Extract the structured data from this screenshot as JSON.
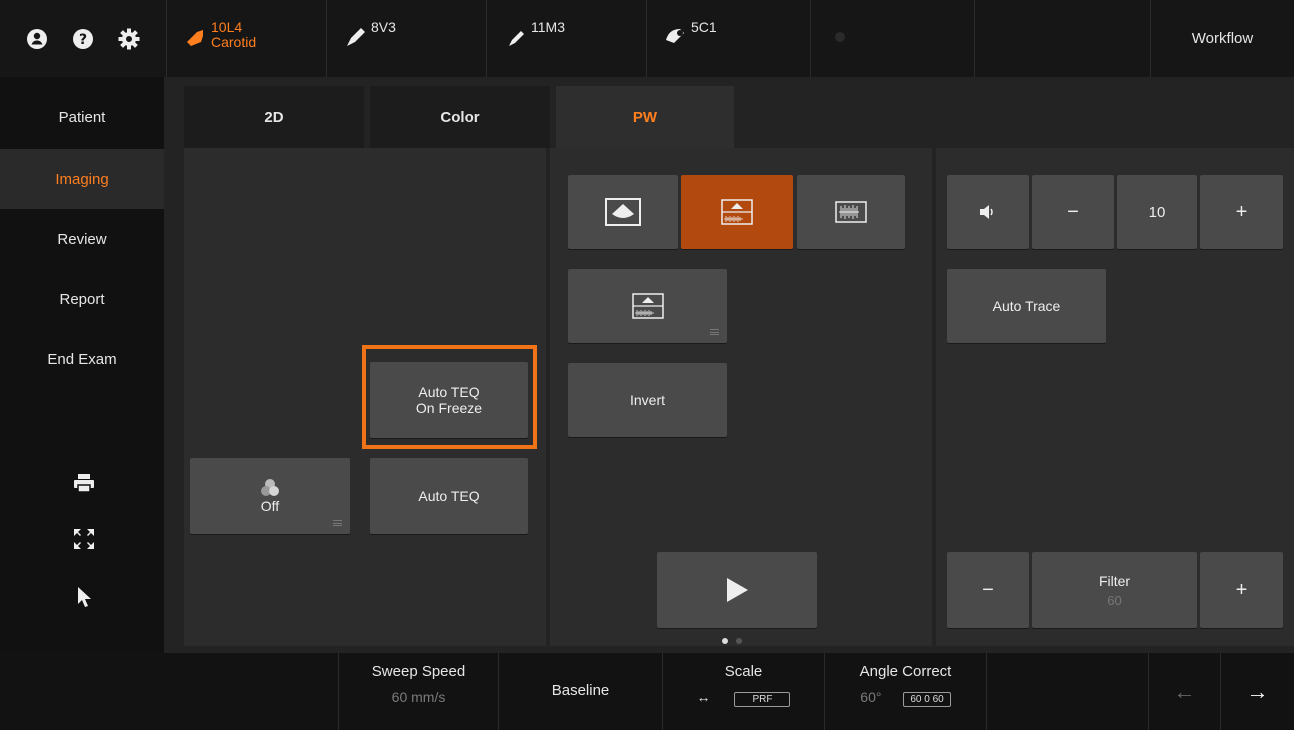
{
  "top": {
    "icons": [
      "user-circle-icon",
      "help-circle-icon",
      "gear-icon"
    ],
    "probes": [
      {
        "name": "10L4",
        "preset": "Carotid",
        "active": true
      },
      {
        "name": "8V3",
        "preset": "",
        "active": false
      },
      {
        "name": "11M3",
        "preset": "",
        "active": false
      },
      {
        "name": "5C1",
        "preset": "",
        "active": false
      }
    ],
    "workflow": "Workflow"
  },
  "sidebar": {
    "items": [
      {
        "label": "Patient",
        "active": false
      },
      {
        "label": "Imaging",
        "active": true
      },
      {
        "label": "Review",
        "active": false
      },
      {
        "label": "Report",
        "active": false
      },
      {
        "label": "End Exam",
        "active": false
      }
    ],
    "tools": [
      "printer-icon",
      "fullscreen-icon",
      "pointer-icon",
      "apps-grid-icon"
    ]
  },
  "tabs": [
    {
      "label": "2D",
      "active": false
    },
    {
      "label": "Color",
      "active": false
    },
    {
      "label": "PW",
      "active": true
    }
  ],
  "controls": {
    "auto_teq_freeze_line1": "Auto TEQ",
    "auto_teq_freeze_line2": "On Freeze",
    "off_label": "Off",
    "auto_teq": "Auto TEQ",
    "invert": "Invert",
    "auto_trace": "Auto Trace",
    "volume_value": "10",
    "minus": "−",
    "plus": "+",
    "filter_label": "Filter",
    "filter_value": "60"
  },
  "bottom": {
    "sweep_speed_label": "Sweep Speed",
    "sweep_speed_value": "60 mm/s",
    "baseline_label": "Baseline",
    "scale_label": "Scale",
    "scale_arrows": "↔",
    "scale_box": "PRF",
    "angle_label": "Angle Correct",
    "angle_value": "60°",
    "angle_box": "60 0 60",
    "prev_arrow": "←",
    "next_arrow": "→"
  },
  "colors": {
    "accent": "#ff7f1f",
    "highlight": "#f07318",
    "active_button": "#b24a10"
  }
}
